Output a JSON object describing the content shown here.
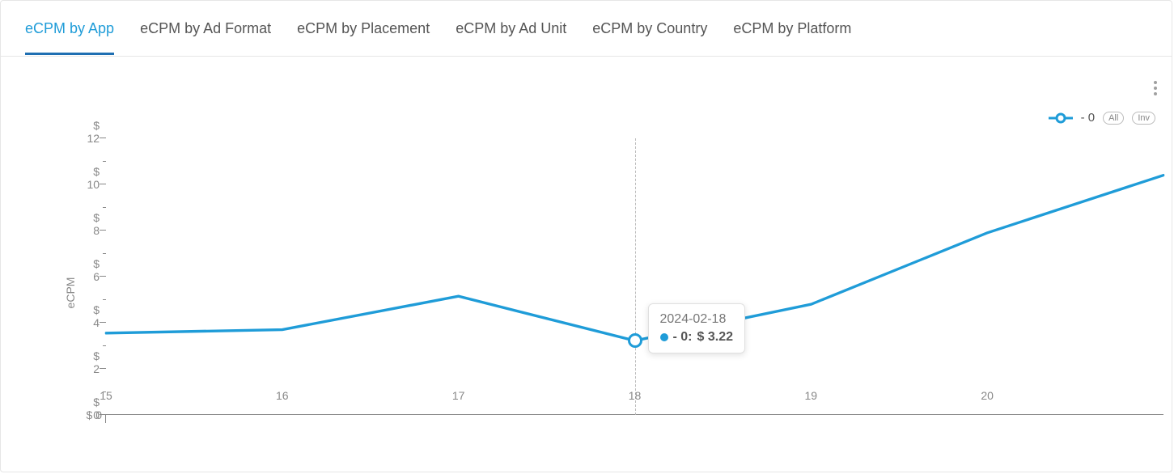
{
  "tabs": [
    {
      "label": "eCPM by App",
      "active": true
    },
    {
      "label": "eCPM by Ad Format",
      "active": false
    },
    {
      "label": "eCPM by Placement",
      "active": false
    },
    {
      "label": "eCPM by Ad Unit",
      "active": false
    },
    {
      "label": "eCPM by Country",
      "active": false
    },
    {
      "label": "eCPM by Platform",
      "active": false
    }
  ],
  "legend": {
    "series_label": " - 0",
    "all_label": "All",
    "inv_label": "Inv"
  },
  "axes": {
    "ylabel": "eCPM",
    "yticks": [
      "$ 0",
      "$ 2",
      "$ 4",
      "$ 6",
      "$ 8",
      "$ 10",
      "$ 12"
    ],
    "xticks": [
      "15",
      "16",
      "17",
      "18",
      "19",
      "20"
    ]
  },
  "tooltip": {
    "date": "2024-02-18",
    "series": " - 0:",
    "value": "$ 3.22"
  },
  "chart_data": {
    "type": "line",
    "title": "eCPM by App",
    "ylabel": "eCPM",
    "xlabel": "",
    "ylim": [
      0,
      12
    ],
    "xlim": [
      15,
      21
    ],
    "x": [
      15,
      16,
      17,
      18,
      19,
      20,
      21
    ],
    "series": [
      {
        "name": " - 0",
        "values": [
          3.55,
          3.7,
          5.15,
          3.22,
          4.8,
          7.9,
          10.4
        ]
      }
    ],
    "hover_index": 3,
    "hover_date": "2024-02-18",
    "hover_value": 3.22
  },
  "colors": {
    "accent": "#1f9cd8",
    "grid": "#e6e6e6",
    "text": "#555"
  }
}
